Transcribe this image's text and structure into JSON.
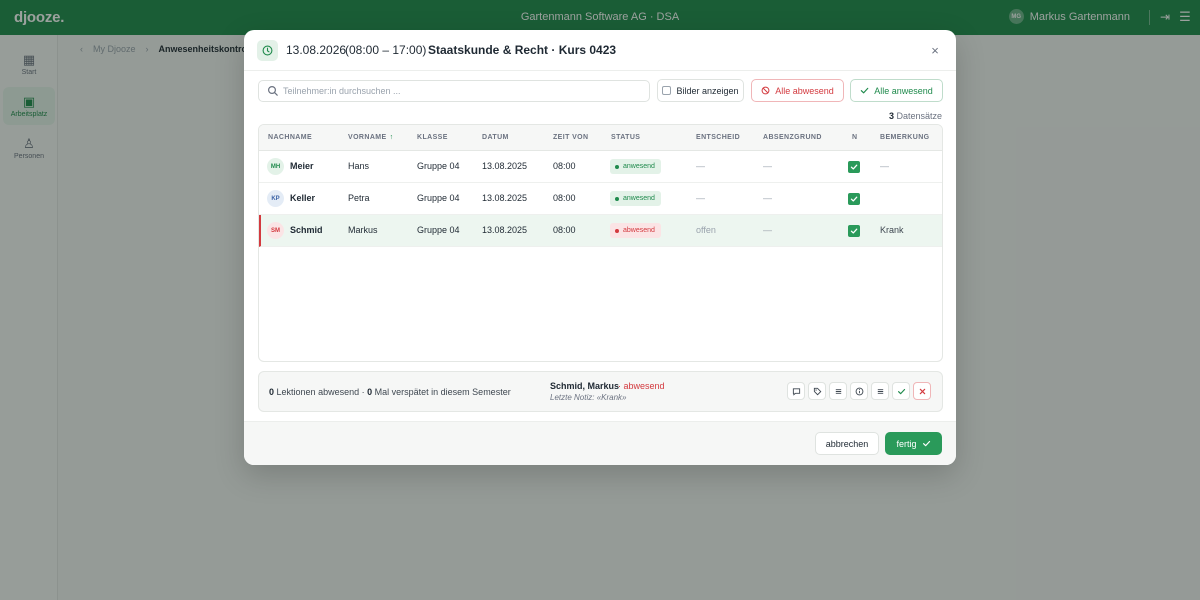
{
  "app": {
    "logo": "djooze.",
    "company": "Gartenmann Software AG · DSA",
    "user_initials": "MG",
    "user_name": "Markus Gartenmann"
  },
  "sidebar": {
    "items": [
      {
        "label": "Start",
        "icon": "grid-icon"
      },
      {
        "label": "Arbeitsplatz",
        "icon": "workspace-icon"
      },
      {
        "label": "Personen",
        "icon": "person-icon"
      }
    ]
  },
  "breadcrumb": {
    "items": [
      "My Djooze",
      "Anwesenheitskontrolle"
    ]
  },
  "modal": {
    "date": "13.08.2026",
    "time": "(08:00 – 17:00)",
    "separator": "·",
    "course": "Staatskunde & Recht · Kurs 0423",
    "search_placeholder": "Teilnehmer:in durchsuchen ...",
    "show_pictures_label": "Bilder anzeigen",
    "all_absent_label": "Alle abwesend",
    "all_present_label": "Alle anwesend",
    "record_count": "3",
    "record_label": "Datensätze",
    "columns": [
      "Nachname",
      "Vorname",
      "Klasse",
      "Datum",
      "Zeit von",
      "Status",
      "Entscheid",
      "Absenzgrund",
      "N",
      "Bemerkung"
    ],
    "sort_indicator": "↑",
    "rows": [
      {
        "initials": "MH",
        "lastname": "Meier",
        "firstname": "Hans",
        "class": "Gruppe 04",
        "date": "13.08.2025",
        "time": "08:00",
        "status": "anwesend",
        "decision": "—",
        "reason": "—",
        "remark": "—"
      },
      {
        "initials": "KP",
        "lastname": "Keller",
        "firstname": "Petra",
        "class": "Gruppe 04",
        "date": "13.08.2025",
        "time": "08:00",
        "status": "anwesend",
        "decision": "—",
        "reason": "—",
        "remark": ""
      },
      {
        "initials": "SM",
        "lastname": "Schmid",
        "firstname": "Markus",
        "class": "Gruppe 04",
        "date": "13.08.2025",
        "time": "08:00",
        "status": "abwesend",
        "decision": "offen",
        "reason": "—",
        "remark": "Krank"
      }
    ],
    "footer": {
      "lessons_absent": "0",
      "lessons_label": "Lektionen abwesend ·",
      "late_count": "0",
      "late_label": "Mal verspätet in diesem Semester",
      "selected_name": "Schmid, Markus",
      "selected_status": "· abwesend",
      "last_note": "Letzte Notiz: «Krank»"
    },
    "cancel_label": "abbrechen",
    "done_label": "fertig"
  },
  "colors": {
    "brand": "#1f8a4c",
    "present": "#1f8a4c",
    "absent": "#d33a3f"
  }
}
